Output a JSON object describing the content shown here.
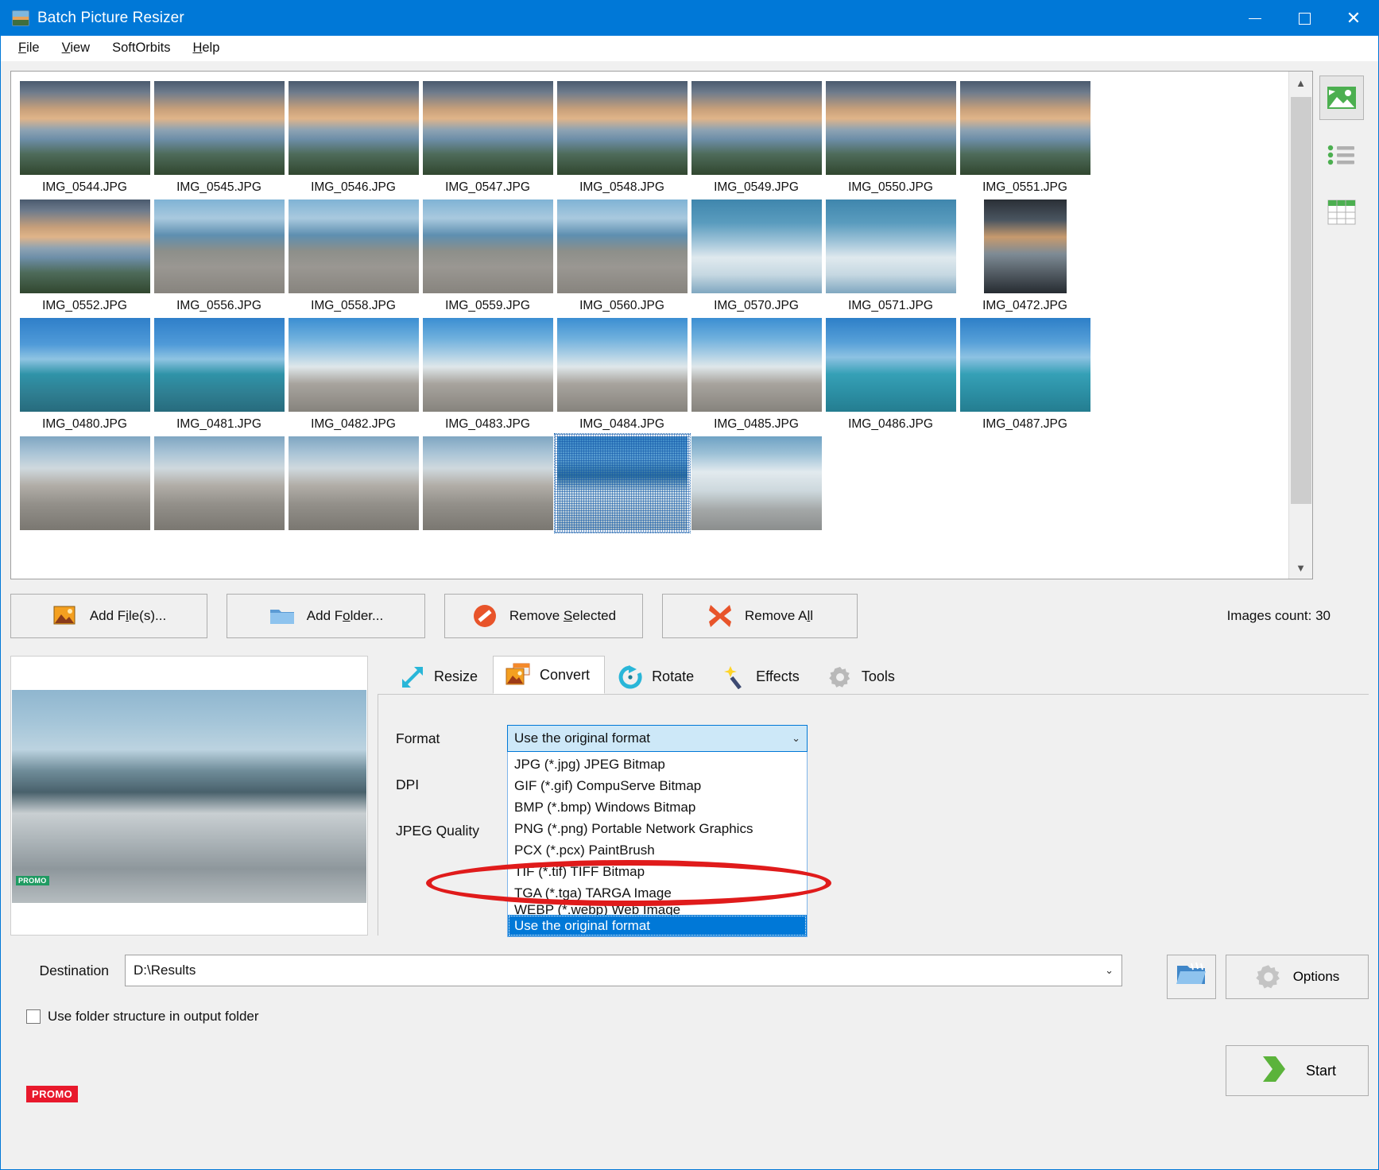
{
  "window": {
    "title": "Batch Picture Resizer",
    "icon": "app-image-icon",
    "minimize": "–",
    "maximize": "□",
    "close": "✕"
  },
  "menu": [
    {
      "label": "File",
      "accel": "F"
    },
    {
      "label": "View",
      "accel": "V"
    },
    {
      "label": "SoftOrbits",
      "accel": ""
    },
    {
      "label": "Help",
      "accel": "H"
    }
  ],
  "thumbnails": {
    "rows": [
      [
        {
          "name": "IMG_0544.JPG",
          "kind": "sunset",
          "selected": false
        },
        {
          "name": "IMG_0545.JPG",
          "kind": "sunset",
          "selected": false
        },
        {
          "name": "IMG_0546.JPG",
          "kind": "sunset",
          "selected": false
        },
        {
          "name": "IMG_0547.JPG",
          "kind": "sunset",
          "selected": false
        },
        {
          "name": "IMG_0548.JPG",
          "kind": "sunset",
          "selected": false
        },
        {
          "name": "IMG_0549.JPG",
          "kind": "sunset",
          "selected": false
        },
        {
          "name": "IMG_0550.JPG",
          "kind": "sunset",
          "selected": false
        },
        {
          "name": "IMG_0551.JPG",
          "kind": "sunset",
          "selected": false
        }
      ],
      [
        {
          "name": "IMG_0552.JPG",
          "kind": "sunset",
          "selected": false
        },
        {
          "name": "IMG_0556.JPG",
          "kind": "beach",
          "selected": false
        },
        {
          "name": "IMG_0558.JPG",
          "kind": "beach",
          "selected": false
        },
        {
          "name": "IMG_0559.JPG",
          "kind": "beach",
          "selected": false
        },
        {
          "name": "IMG_0560.JPG",
          "kind": "beach",
          "selected": false
        },
        {
          "name": "IMG_0570.JPG",
          "kind": "surf",
          "selected": false
        },
        {
          "name": "IMG_0571.JPG",
          "kind": "surf",
          "selected": false
        },
        {
          "name": "IMG_0472.JPG",
          "kind": "window",
          "selected": false,
          "portrait": true
        }
      ],
      [
        {
          "name": "IMG_0480.JPG",
          "kind": "sea",
          "selected": false
        },
        {
          "name": "IMG_0481.JPG",
          "kind": "sea",
          "selected": false
        },
        {
          "name": "IMG_0482.JPG",
          "kind": "shore",
          "selected": false
        },
        {
          "name": "IMG_0483.JPG",
          "kind": "shore",
          "selected": false
        },
        {
          "name": "IMG_0484.JPG",
          "kind": "shore",
          "selected": false
        },
        {
          "name": "IMG_0485.JPG",
          "kind": "shore",
          "selected": false
        },
        {
          "name": "IMG_0486.JPG",
          "kind": "sup",
          "selected": false
        },
        {
          "name": "IMG_0487.JPG",
          "kind": "sup",
          "selected": false
        }
      ],
      [
        {
          "name": "",
          "kind": "pebble",
          "selected": false
        },
        {
          "name": "",
          "kind": "pebble",
          "selected": false
        },
        {
          "name": "",
          "kind": "pebble",
          "selected": false
        },
        {
          "name": "",
          "kind": "pebble",
          "selected": false
        },
        {
          "name": "",
          "kind": "selected-surf",
          "selected": true
        },
        {
          "name": "",
          "kind": "foam",
          "selected": false
        }
      ]
    ],
    "scroll_up": "⌃",
    "scroll_down": "⌄"
  },
  "view_modes": [
    {
      "name": "thumbnail-view",
      "active": true
    },
    {
      "name": "list-view",
      "active": false
    },
    {
      "name": "details-view",
      "active": false
    }
  ],
  "actions": {
    "add_files": "Add File(s)...",
    "add_folder": "Add Folder...",
    "remove_selected": "Remove Selected",
    "remove_all": "Remove All",
    "images_count": "Images count: 30"
  },
  "tabs": [
    {
      "label": "Resize",
      "icon": "resize-arrows-icon",
      "active": false
    },
    {
      "label": "Convert",
      "icon": "convert-images-icon",
      "active": true
    },
    {
      "label": "Rotate",
      "icon": "rotate-circular-arrow-icon",
      "active": false
    },
    {
      "label": "Effects",
      "icon": "magic-wand-icon",
      "active": false
    },
    {
      "label": "Tools",
      "icon": "gear-icon",
      "active": false
    }
  ],
  "convert": {
    "format_label": "Format",
    "dpi_label": "DPI",
    "jpeg_quality_label": "JPEG Quality",
    "format_value": "Use the original format",
    "caret": "⌄",
    "format_options": [
      "JPG (*.jpg) JPEG Bitmap",
      "GIF (*.gif) CompuServe Bitmap",
      "BMP (*.bmp) Windows Bitmap",
      "PNG (*.png) Portable Network Graphics",
      "PCX (*.pcx) PaintBrush",
      "TIF (*.tif) TIFF Bitmap",
      "TGA (*.tga) TARGA Image",
      "WEBP (*.webp) Web Image",
      "Use the original format"
    ],
    "selected_option": "Use the original format"
  },
  "preview": {
    "watermark": "PROMO"
  },
  "footer": {
    "destination_label": "Destination",
    "destination_value": "D:\\Results",
    "destination_caret": "⌄",
    "browse_icon": "folder-browse-icon",
    "options_label": "Options",
    "options_icon": "gear-icon",
    "use_folder_structure": "Use folder structure in output folder",
    "use_folder_structure_checked": false,
    "promo_badge": "PROMO",
    "start_label": "Start",
    "start_icon": "green-arrow-icon"
  },
  "colors": {
    "accent": "#0078d7",
    "highlight": "#0078d7",
    "annotation": "#e01b1b",
    "promo": "#e8192c",
    "start_green": "#5bb33b"
  }
}
